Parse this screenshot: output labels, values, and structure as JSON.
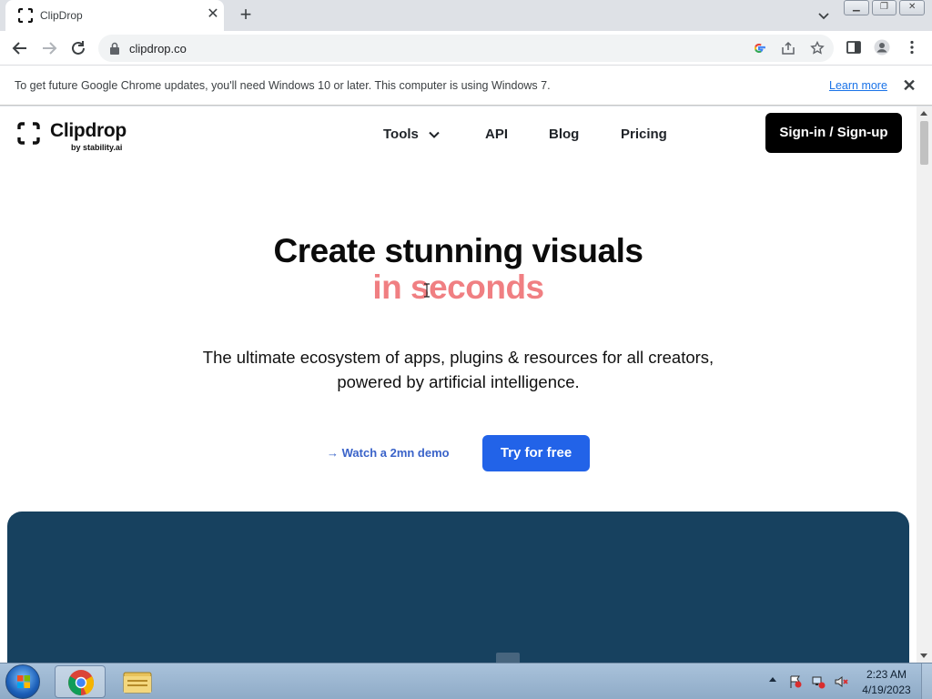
{
  "browser": {
    "tab": {
      "title": "ClipDrop",
      "favicon": "clipdrop-logo-icon"
    },
    "url": "clipdrop.co",
    "window_controls": [
      "minimize",
      "restore",
      "close"
    ]
  },
  "infobar": {
    "message": "To get future Google Chrome updates, you'll need Windows 10 or later. This computer is using Windows 7.",
    "link": "Learn more"
  },
  "site": {
    "logo": {
      "name": "Clipdrop",
      "sub": "by stability.ai"
    },
    "nav": {
      "tools": "Tools",
      "api": "API",
      "blog": "Blog",
      "pricing": "Pricing"
    },
    "signin": "Sign-in / Sign-up",
    "hero": {
      "headline": "Create stunning visuals",
      "accent": "in seconds",
      "sub1": "The ultimate ecosystem of apps, plugins & resources for all creators,",
      "sub2": "powered by artificial intelligence.",
      "demo": "→ Watch a 2mn demo",
      "cta": "Try for free"
    },
    "colors": {
      "accent": "#f07f82",
      "cta": "#2263e8",
      "hero_bg": "#17415f"
    }
  },
  "taskbar": {
    "time": "2:23 AM",
    "date": "4/19/2023",
    "apps": [
      "chrome-icon",
      "file-explorer-icon"
    ],
    "tray": [
      "flag-icon",
      "network-icon",
      "volume-muted-icon"
    ]
  }
}
